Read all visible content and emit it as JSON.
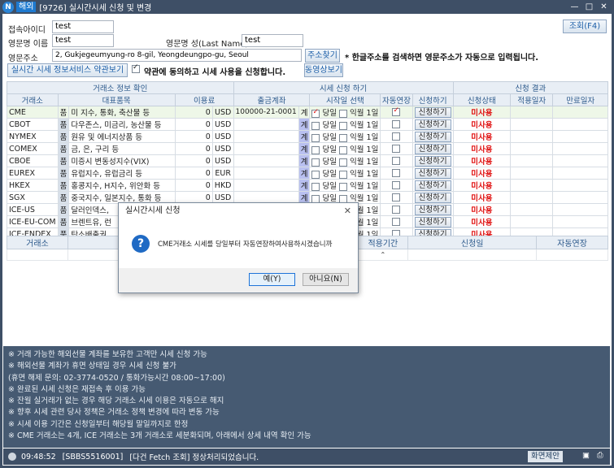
{
  "window": {
    "app_icon": "N",
    "menu_tag": "해외",
    "title": "[9726] 실시간시세 신청 및 변경",
    "controls": [
      "—",
      "□",
      "✕"
    ]
  },
  "form": {
    "access_id_label": "접속아이디",
    "access_id_value": "test",
    "first_name_label": "영문명 이름",
    "first_name_value": "test",
    "last_name_label": "영문명 성(Last Name)",
    "last_name_value": "test",
    "address_label": "영문주소",
    "address_value": "2, Gukjegeumyung-ro 8-gil, Yeongdeungpo-gu, Seoul",
    "address_search_button": "주소찾기",
    "address_note": "* 한글주소를 검색하면 영문주소가 자동으로 입력됩니다.",
    "terms_button": "실시간 시세 정보서비스 약관보기",
    "agree_text": "약관에 동의하고 시세 사용을 신청합니다.",
    "agree_checked": true,
    "video_button": "동영상보기",
    "query_button": "조회(F4)"
  },
  "grid": {
    "group_headers": [
      "거래소 정보 확인",
      "시세 신청 하기",
      "신청 결과"
    ],
    "columns": [
      "거래소",
      "대표품목",
      "이용료",
      "출금계좌",
      "시작일 선택",
      "자동연장",
      "신청하기",
      "신청상태",
      "적용일자",
      "만료일자"
    ],
    "pum_label": "품",
    "gye_label": "계",
    "today_label": "당일",
    "nextmonth_label": "익월 1일",
    "apply_label": "신청하기",
    "rows": [
      {
        "exchange": "CME",
        "items": "미 지수, 통화, 축산물 등",
        "fee": "0",
        "cur": "USD",
        "account": "100000-21-0001",
        "today": true,
        "next": false,
        "auto": true,
        "status": "미사용"
      },
      {
        "exchange": "CBOT",
        "items": "다우존스, 미금리, 농산물 등",
        "fee": "0",
        "cur": "USD",
        "account": "",
        "today": false,
        "next": false,
        "auto": false,
        "status": "미사용"
      },
      {
        "exchange": "NYMEX",
        "items": "원유 및 에너지상품 등",
        "fee": "0",
        "cur": "USD",
        "account": "",
        "today": false,
        "next": false,
        "auto": false,
        "status": "미사용"
      },
      {
        "exchange": "COMEX",
        "items": "금, 은, 구리 등",
        "fee": "0",
        "cur": "USD",
        "account": "",
        "today": false,
        "next": false,
        "auto": false,
        "status": "미사용"
      },
      {
        "exchange": "CBOE",
        "items": "미증시 변동성지수(VIX)",
        "fee": "0",
        "cur": "USD",
        "account": "",
        "today": false,
        "next": false,
        "auto": false,
        "status": "미사용"
      },
      {
        "exchange": "EUREX",
        "items": "유럽지수, 유럽금리 등",
        "fee": "0",
        "cur": "EUR",
        "account": "",
        "today": false,
        "next": false,
        "auto": false,
        "status": "미사용"
      },
      {
        "exchange": "HKEX",
        "items": "홍콩지수, H지수, 위안화 등",
        "fee": "0",
        "cur": "HKD",
        "account": "",
        "today": false,
        "next": false,
        "auto": false,
        "status": "미사용"
      },
      {
        "exchange": "SGX",
        "items": "중국지수, 일본지수, 통화 등",
        "fee": "0",
        "cur": "USD",
        "account": "",
        "today": false,
        "next": false,
        "auto": false,
        "status": "미사용"
      },
      {
        "exchange": "ICE-US",
        "items": "달러인덱스,",
        "fee": "",
        "cur": "",
        "account": "",
        "today": false,
        "next": false,
        "auto": false,
        "status": "미사용"
      },
      {
        "exchange": "ICE-EU-COM",
        "items": "브렌트유, 런",
        "fee": "",
        "cur": "",
        "account": "",
        "today": false,
        "next": false,
        "auto": false,
        "status": "미사용"
      },
      {
        "exchange": "ICE-ENDEX",
        "items": "탄소배출권",
        "fee": "",
        "cur": "",
        "account": "",
        "today": false,
        "next": false,
        "auto": false,
        "status": "미사용"
      }
    ]
  },
  "grid2": {
    "columns": [
      "거래소",
      "적용기간",
      "신청일",
      "자동연장"
    ]
  },
  "info": [
    "※ 거래 가능한 해외선물 계좌를 보유한 고객만 시세 신청 가능",
    "※ 해외선물 계좌가 휴면 상태일 경우 시세 신청 불가",
    "   (휴면 해제 문의: 02-3774-0520 / 통화가능시간 08:00~17:00)",
    "※ 완료된 시세 신청은 재접속 후 이용 가능",
    "※ 잔월 실거래가 없는 경우 해당 거래소 시세 이용은 자동으로 해지",
    "※ 향후 시세 관련 당사 정책은 거래소 정책 변경에 따라 변동 가능",
    "※ 시세 이용 기간은 신청일부터 해당월 말일까지로 한정",
    "※ CME 거래소는 4개, ICE 거래소는 3개 거래소로 세분화되며, 아래에서 상세 내역 확인 가능"
  ],
  "status": {
    "time": "09:48:52",
    "code": "[SBBS5516001]",
    "message": "[다건 Fetch 조회] 정상처리되었습니다.",
    "screen_button": "화면제안"
  },
  "dialog": {
    "title": "실시간시세 신청",
    "message": "CME거래소 시세를 당일부터 자동연장하여사용하시겠습니까",
    "yes": "예(Y)",
    "no": "아니요(N)"
  }
}
